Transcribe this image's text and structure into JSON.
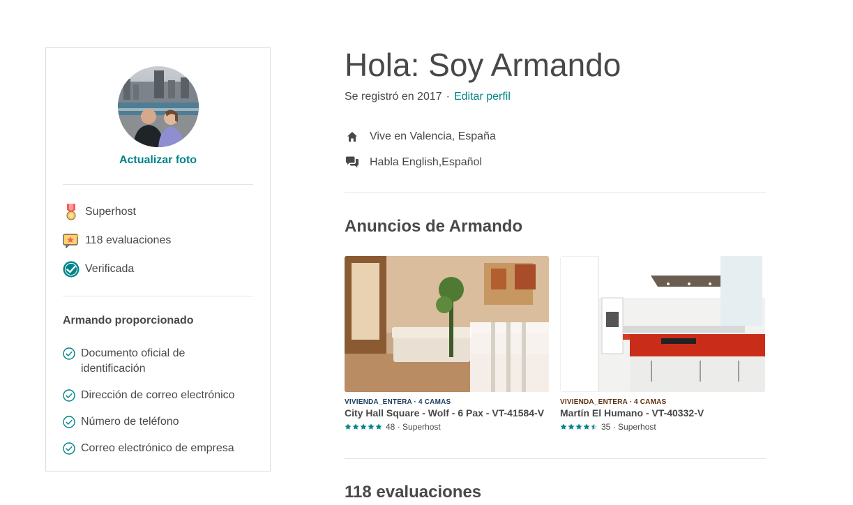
{
  "sidebar": {
    "update_photo": "Actualizar foto",
    "badges": [
      {
        "icon": "medal-icon",
        "label": "Superhost"
      },
      {
        "icon": "review-star-icon",
        "label": "118 evaluaciones"
      },
      {
        "icon": "verified-icon",
        "label": "Verificada"
      }
    ],
    "provided_title": "Armando proporcionado",
    "provided_items": [
      {
        "icon": "check-circle-icon",
        "label": "Documento oficial de identificación"
      },
      {
        "icon": "check-circle-icon",
        "label": "Dirección de correo electrónico"
      },
      {
        "icon": "check-circle-icon",
        "label": "Número de teléfono"
      },
      {
        "icon": "check-circle-icon",
        "label": "Correo electrónico de empresa"
      }
    ]
  },
  "profile": {
    "title": "Hola: Soy Armando",
    "joined": "Se registró en 2017",
    "separator": "·",
    "edit_profile": "Editar perfil",
    "lives": "Vive en Valencia, España",
    "speaks": "Habla English,Español"
  },
  "listings_section": {
    "title": "Anuncios de Armando",
    "listings": [
      {
        "kicker": "VIVIENDA_ENTERA · 4 CAMAS",
        "kicker_color": "#1a3b5c",
        "name": "City Hall Square - Wolf - 6 Pax - VT-41584-V",
        "rating": 5,
        "reviews": "48",
        "badge": "· Superhost"
      },
      {
        "kicker": "VIVIENDA_ENTERA · 4 CAMAS",
        "kicker_color": "#5c3010",
        "name": "Martín El Humano - VT-40332-V",
        "rating": 4.5,
        "reviews": "35",
        "badge": "· Superhost"
      }
    ]
  },
  "reviews_section": {
    "title": "118 evaluaciones"
  },
  "colors": {
    "accent": "#008489",
    "text": "#484848",
    "divider": "#e4e4e4",
    "star": "#008489"
  }
}
